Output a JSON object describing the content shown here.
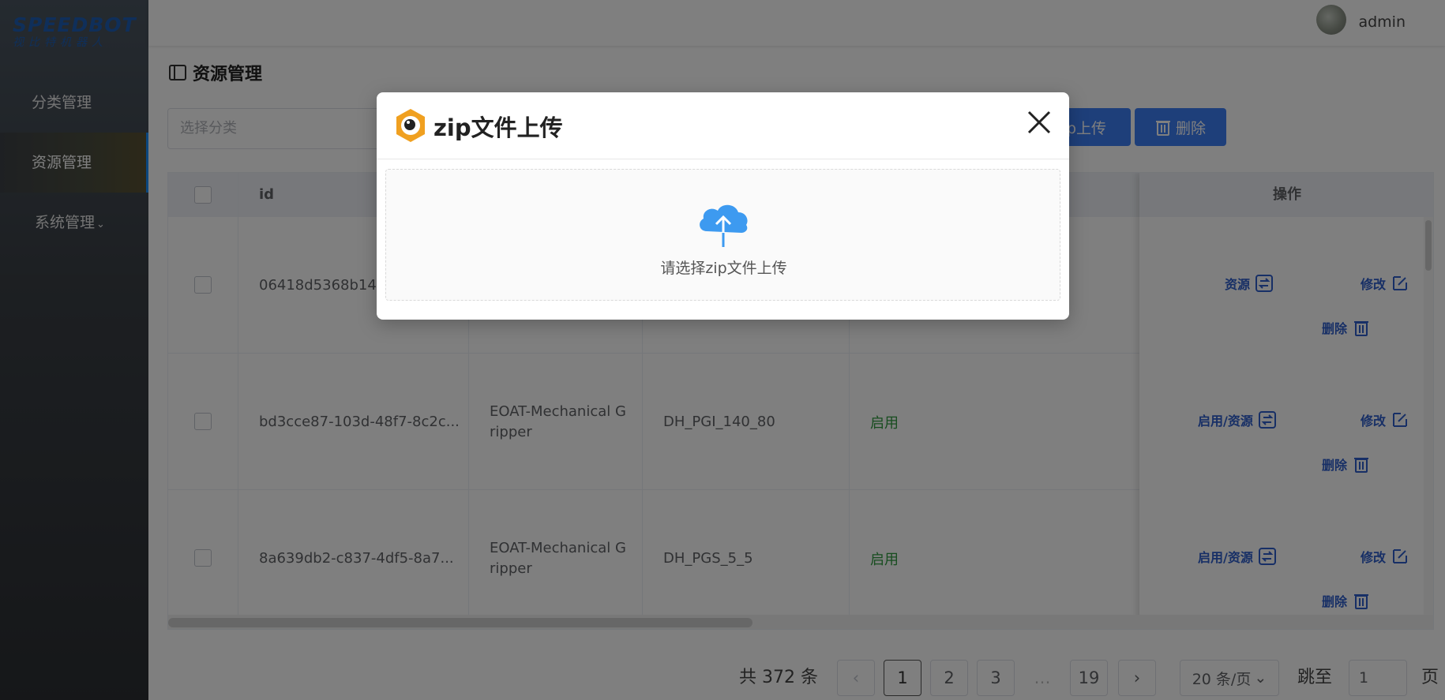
{
  "brand": {
    "name": "SPEEDBOT",
    "subtitle": "视比特机器人",
    "color": "#1f5fb5"
  },
  "sidebar": {
    "items": [
      {
        "label": "分类管理",
        "active": false
      },
      {
        "label": "资源管理",
        "active": true
      },
      {
        "label": "系统管理",
        "active": false,
        "has_submenu": true
      }
    ]
  },
  "header": {
    "username": "admin"
  },
  "page": {
    "title": "资源管理",
    "title_icon": "book-icon"
  },
  "toolbar": {
    "category_placeholder": "选择分类",
    "upload_label": "p上传",
    "delete_label": "删除"
  },
  "table": {
    "columns": {
      "id": "id",
      "ops": "操作"
    },
    "rows": [
      {
        "id": "06418d5368b14df",
        "category": "",
        "name": "",
        "status": "",
        "op_enable": "资源",
        "op_edit": "修改",
        "op_delete": "删除"
      },
      {
        "id": "bd3cce87-103d-48f7-8c2c...",
        "category_line1": "EOAT-Mechanical G",
        "category_line2": "ripper",
        "name": "DH_PGI_140_80",
        "status": "启用",
        "op_enable": "启用/资源",
        "op_edit": "修改",
        "op_delete": "删除"
      },
      {
        "id": "8a639db2-c837-4df5-8a7...",
        "category_line1": "EOAT-Mechanical G",
        "category_line2": "ripper",
        "name": "DH_PGS_5_5",
        "status": "启用",
        "op_enable": "启用/资源",
        "op_edit": "修改",
        "op_delete": "删除"
      }
    ]
  },
  "pagination": {
    "total": "共 372 条",
    "pages": [
      "1",
      "2",
      "3",
      "…",
      "19"
    ],
    "current": "1",
    "prev": "‹",
    "next": "›",
    "page_size": "20 条/页",
    "jump_label": "跳至",
    "jump_value": "1",
    "page_suffix": "页"
  },
  "modal": {
    "title": "zip文件上传",
    "drop_text": "请选择zip文件上传",
    "logo_color": "#f0a020",
    "cloud_color": "#3d9af0"
  }
}
